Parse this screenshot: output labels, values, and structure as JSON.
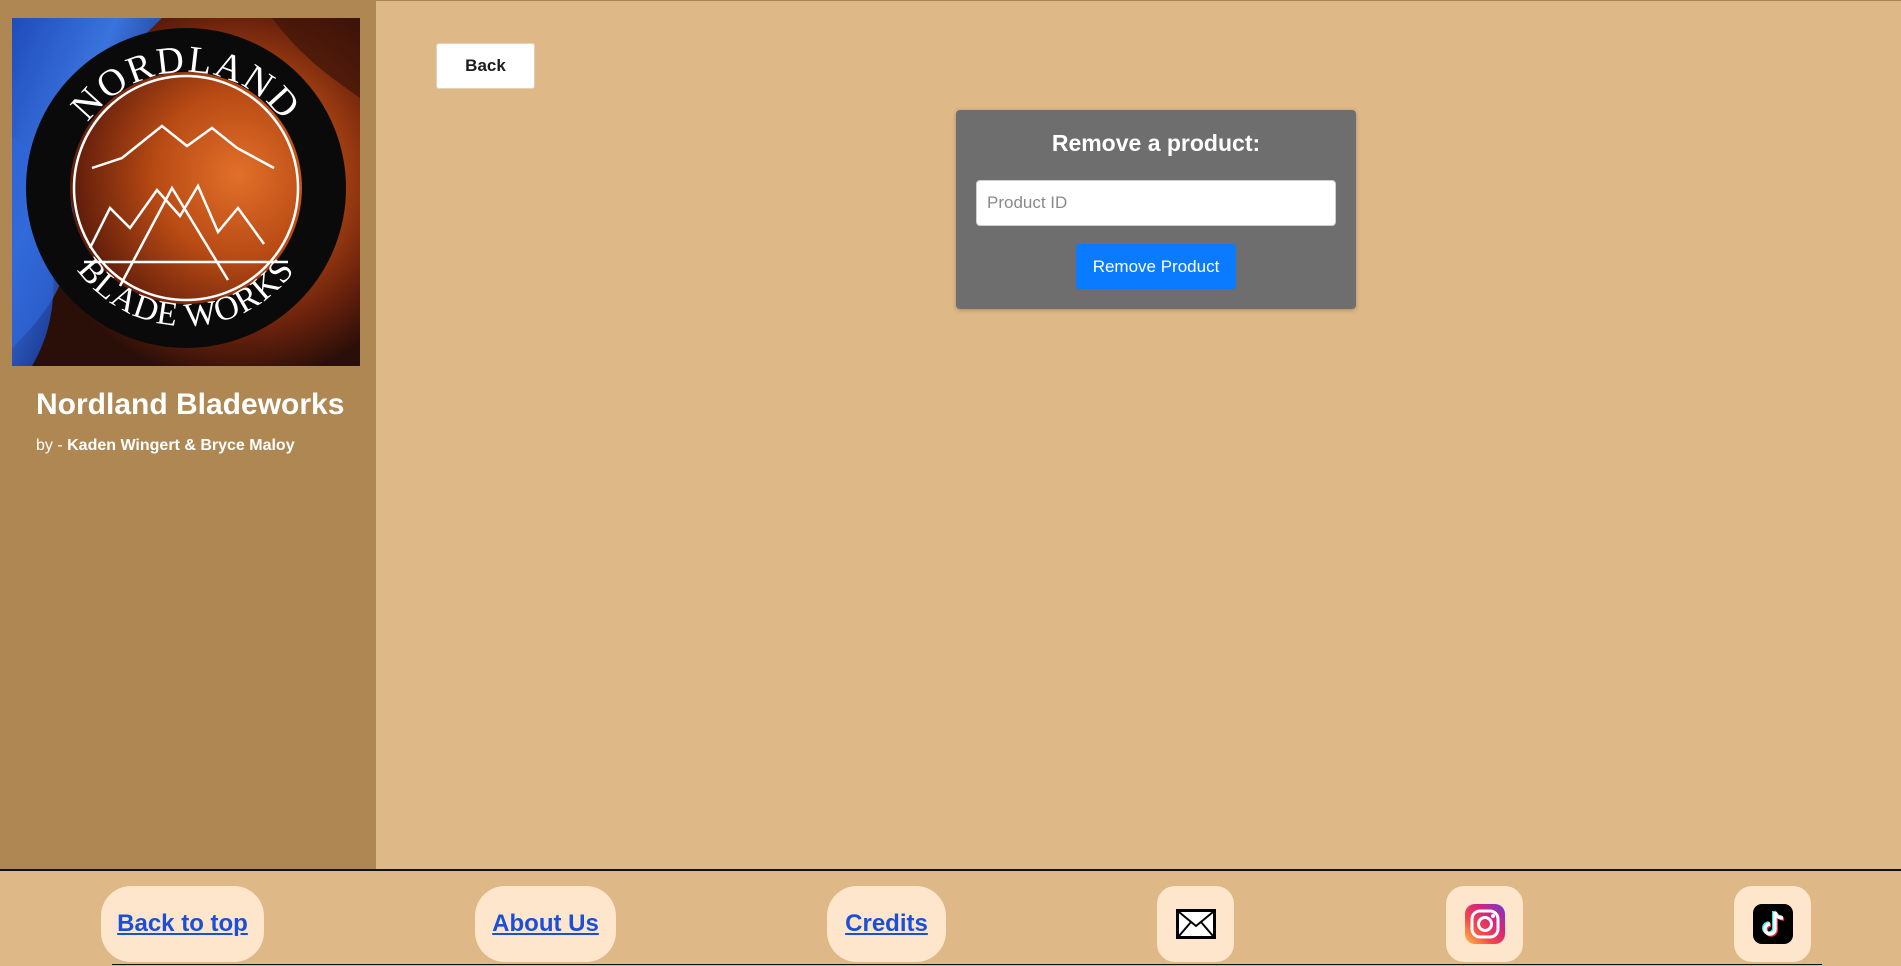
{
  "brand": {
    "logo_alt": "Nordland Blade Works logo",
    "logo_text_top": "NORDLAND",
    "logo_text_bottom": "BLADE WORKS",
    "title": "Nordland Bladeworks",
    "byline_prefix": "by - ",
    "authors": "Kaden Wingert & Bryce Maloy"
  },
  "nav": {
    "back_label": "Back"
  },
  "remove_form": {
    "title": "Remove a product:",
    "product_id_placeholder": "Product ID",
    "product_id_value": "",
    "submit_label": "Remove Product"
  },
  "footer": {
    "links": [
      {
        "label": "Back to top"
      },
      {
        "label": "About Us"
      },
      {
        "label": "Credits"
      }
    ],
    "social": [
      {
        "icon": "mail-icon"
      },
      {
        "icon": "instagram-icon"
      },
      {
        "icon": "tiktok-icon"
      }
    ]
  },
  "colors": {
    "page_bg": "#deb887",
    "sidebar_bg": "#ae8753",
    "panel_bg": "#6e6e6e",
    "accent_blue": "#0a7bff",
    "link_blue": "#1a4fd8",
    "footer_pill_bg": "#fde6cc"
  }
}
